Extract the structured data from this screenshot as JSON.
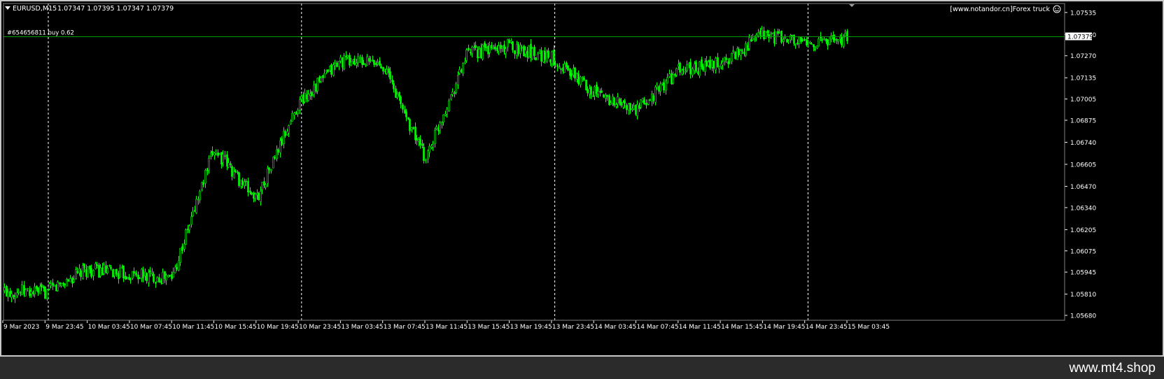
{
  "header": {
    "symbol": "EURUSD,M15",
    "ohlc": "1.07347 1.07395 1.07347 1.07379",
    "watermark": "[www.notandor.cn]Forex truck"
  },
  "order": {
    "label": "#654656811 buy 0.62",
    "price": 1.0739
  },
  "current_price_label": "1.07379",
  "footer": {
    "url": "www.mt4.shop"
  },
  "colors": {
    "background": "#000000",
    "candles": "#00ff00",
    "order_line": "#00a000",
    "grid": "#ffffff",
    "text": "#ffffff",
    "price_label_bg": "#ffffff",
    "price_label_text": "#000000"
  },
  "chart_data": {
    "type": "candlestick",
    "x_tick_labels": [
      "9 Mar 2023",
      "9 Mar 23:45",
      "10 Mar 03:45",
      "10 Mar 07:45",
      "10 Mar 11:45",
      "10 Mar 15:45",
      "10 Mar 19:45",
      "10 Mar 23:45",
      "13 Mar 03:45",
      "13 Mar 07:45",
      "13 Mar 11:45",
      "13 Mar 15:45",
      "13 Mar 19:45",
      "13 Mar 23:45",
      "14 Mar 03:45",
      "14 Mar 07:45",
      "14 Mar 11:45",
      "14 Mar 15:45",
      "14 Mar 19:45",
      "14 Mar 23:45",
      "15 Mar 03:45"
    ],
    "y_tick_labels": [
      "1.07535",
      "1.07400",
      "1.07270",
      "1.07135",
      "1.07005",
      "1.06875",
      "1.06740",
      "1.06605",
      "1.06470",
      "1.06340",
      "1.06205",
      "1.06075",
      "1.05945",
      "1.05810",
      "1.05680"
    ],
    "ylim": [
      1.0565,
      1.0759
    ],
    "day_separators": [
      "9 Mar 23:45",
      "10 Mar 23:45",
      "13 Mar 23:45",
      "14 Mar 23:45"
    ],
    "close_path": [
      [
        "9 Mar 2023",
        1.0583
      ],
      [
        "9 Mar 23:45",
        1.0582
      ],
      [
        "10 Mar 03:45",
        1.0596
      ],
      [
        "10 Mar 07:45",
        1.0593
      ],
      [
        "10 Mar 11:45",
        1.0591
      ],
      [
        "10 Mar 15:45",
        1.067
      ],
      [
        "10 Mar 19:45",
        1.0639
      ],
      [
        "10 Mar 23:45",
        1.0698
      ],
      [
        "13 Mar 03:45",
        1.0724
      ],
      [
        "13 Mar 07:45",
        1.0722
      ],
      [
        "13 Mar 11:45",
        1.0664
      ],
      [
        "13 Mar 15:45",
        1.0728
      ],
      [
        "13 Mar 19:45",
        1.0733
      ],
      [
        "13 Mar 23:45",
        1.0726
      ],
      [
        "14 Mar 03:45",
        1.0705
      ],
      [
        "14 Mar 07:45",
        1.0693
      ],
      [
        "14 Mar 11:45",
        1.0718
      ],
      [
        "14 Mar 15:45",
        1.0722
      ],
      [
        "14 Mar 19:45",
        1.074
      ],
      [
        "14 Mar 23:45",
        1.0734
      ],
      [
        "15 Mar 03:45",
        1.0738
      ]
    ],
    "candle_count": 475,
    "grid": false
  }
}
